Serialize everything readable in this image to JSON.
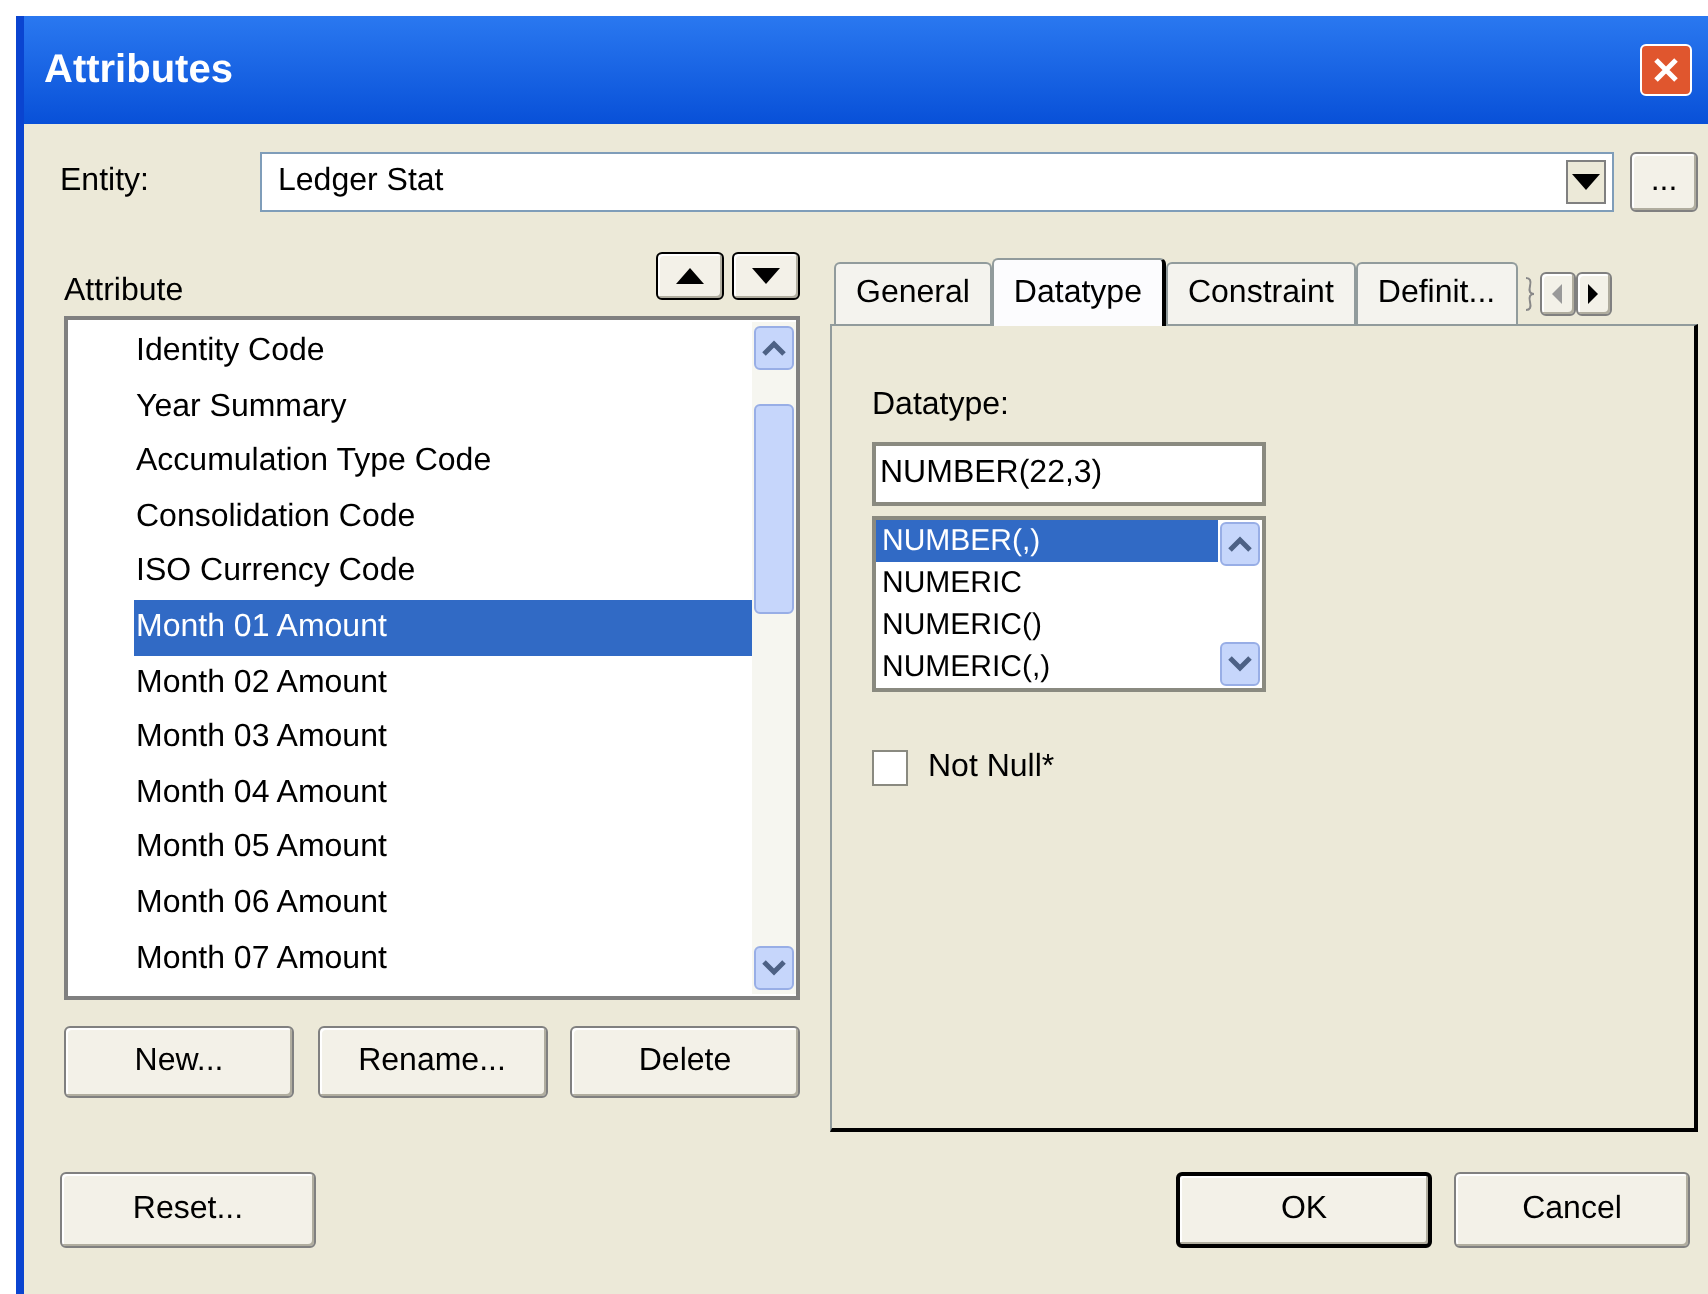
{
  "window": {
    "title": "Attributes"
  },
  "entity": {
    "label": "Entity:",
    "value": "Ledger Stat",
    "browse": "..."
  },
  "attribute_list": {
    "label": "Attribute",
    "items": [
      {
        "text": "Identity Code",
        "selected": false
      },
      {
        "text": "Year Summary",
        "selected": false
      },
      {
        "text": "Accumulation Type Code",
        "selected": false
      },
      {
        "text": "Consolidation Code",
        "selected": false
      },
      {
        "text": "ISO Currency Code",
        "selected": false
      },
      {
        "text": "Month 01 Amount",
        "selected": true
      },
      {
        "text": "Month 02 Amount",
        "selected": false
      },
      {
        "text": "Month 03 Amount",
        "selected": false
      },
      {
        "text": "Month 04 Amount",
        "selected": false
      },
      {
        "text": "Month 05 Amount",
        "selected": false
      },
      {
        "text": "Month 06 Amount",
        "selected": false
      },
      {
        "text": "Month 07 Amount",
        "selected": false
      }
    ]
  },
  "list_buttons": [
    "New...",
    "Rename...",
    "Delete"
  ],
  "tabs": [
    {
      "label": "General",
      "selected": false
    },
    {
      "label": "Datatype",
      "selected": true
    },
    {
      "label": "Constraint",
      "selected": false
    },
    {
      "label": "Definit...",
      "selected": false
    }
  ],
  "datatype": {
    "label": "Datatype:",
    "value": "NUMBER(22,3)",
    "options": [
      {
        "text": "NUMBER(,)",
        "selected": true
      },
      {
        "text": "NUMERIC",
        "selected": false
      },
      {
        "text": "NUMERIC()",
        "selected": false
      },
      {
        "text": "NUMERIC(,)",
        "selected": false
      }
    ]
  },
  "not_null": {
    "label": "Not Null*",
    "checked": false
  },
  "footer_buttons": [
    {
      "label": "Reset...",
      "default": false
    },
    {
      "label": "OK",
      "default": true
    },
    {
      "label": "Cancel",
      "default": false
    }
  ]
}
